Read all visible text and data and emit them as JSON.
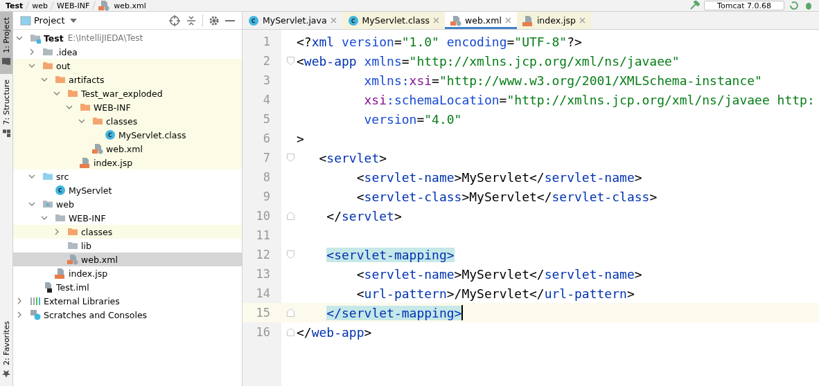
{
  "breadcrumb": [
    "Test",
    "web",
    "WEB-INF",
    "web.xml"
  ],
  "run_config": {
    "label": "Tomcat 7.0.68"
  },
  "tool_stripe": {
    "top": [
      {
        "label": "1: Project",
        "selected": true
      },
      {
        "label": "7: Structure",
        "selected": false
      }
    ],
    "bottom": [
      {
        "label": "2: Favorites",
        "selected": false
      }
    ]
  },
  "project_panel": {
    "title": "Project",
    "tree": [
      {
        "label": "Test",
        "detail": "E:\\IntelliJIEDA\\Test",
        "kind": "module",
        "expanded": true,
        "selected": false,
        "excluded": false,
        "children": [
          {
            "label": ".idea",
            "kind": "folder",
            "expanded": false,
            "selected": false,
            "excluded": false
          },
          {
            "label": "out",
            "kind": "folder_excluded",
            "expanded": true,
            "selected": false,
            "excluded": true,
            "children": [
              {
                "label": "artifacts",
                "kind": "folder_excluded",
                "expanded": true,
                "selected": false,
                "excluded": true,
                "children": [
                  {
                    "label": "Test_war_exploded",
                    "kind": "folder_excluded",
                    "expanded": true,
                    "selected": false,
                    "excluded": true,
                    "children": [
                      {
                        "label": "WEB-INF",
                        "kind": "folder_excluded",
                        "expanded": true,
                        "selected": false,
                        "excluded": true,
                        "children": [
                          {
                            "label": "classes",
                            "kind": "folder_excluded",
                            "expanded": true,
                            "selected": false,
                            "excluded": true,
                            "children": [
                              {
                                "label": "MyServlet.class",
                                "kind": "class",
                                "selected": false,
                                "excluded": true
                              }
                            ]
                          },
                          {
                            "label": "web.xml",
                            "kind": "xml",
                            "selected": false,
                            "excluded": true
                          }
                        ]
                      },
                      {
                        "label": "index.jsp",
                        "kind": "jsp",
                        "selected": false,
                        "excluded": true
                      }
                    ]
                  }
                ]
              }
            ]
          },
          {
            "label": "src",
            "kind": "folder_source",
            "expanded": true,
            "selected": false,
            "excluded": false,
            "children": [
              {
                "label": "MyServlet",
                "kind": "class",
                "selected": false,
                "excluded": false
              }
            ]
          },
          {
            "label": "web",
            "kind": "folder_web",
            "expanded": true,
            "selected": false,
            "excluded": false,
            "children": [
              {
                "label": "WEB-INF",
                "kind": "folder",
                "expanded": true,
                "selected": false,
                "excluded": false,
                "children": [
                  {
                    "label": "classes",
                    "kind": "folder_excluded",
                    "expanded": false,
                    "selected": false,
                    "excluded": true
                  },
                  {
                    "label": "lib",
                    "kind": "folder",
                    "selected": false,
                    "excluded": false
                  },
                  {
                    "label": "web.xml",
                    "kind": "xml",
                    "selected": true,
                    "excluded": false
                  }
                ]
              },
              {
                "label": "index.jsp",
                "kind": "jsp",
                "selected": false,
                "excluded": false
              }
            ]
          },
          {
            "label": "Test.iml",
            "kind": "iml",
            "selected": false,
            "excluded": false
          }
        ]
      },
      {
        "label": "External Libraries",
        "kind": "libraries",
        "expanded": false,
        "selected": false,
        "excluded": false
      },
      {
        "label": "Scratches and Consoles",
        "kind": "scratches",
        "expanded": false,
        "selected": false,
        "excluded": false
      }
    ]
  },
  "editor": {
    "tabs": [
      {
        "label": "MyServlet.java",
        "kind": "class",
        "selected": false,
        "excluded": false
      },
      {
        "label": "MyServlet.class",
        "kind": "class",
        "selected": false,
        "excluded": true
      },
      {
        "label": "web.xml",
        "kind": "xml",
        "selected": true,
        "excluded": false
      },
      {
        "label": "index.jsp",
        "kind": "jsp",
        "selected": false,
        "excluded": true
      }
    ],
    "lines": [
      {
        "number": "1",
        "current": false,
        "tokens": [
          {
            "kind": "punct",
            "text": "<?"
          },
          {
            "kind": "tag",
            "text": "xml"
          },
          {
            "kind": "attr",
            "text": " version"
          },
          {
            "kind": "punct",
            "text": "="
          },
          {
            "kind": "value",
            "text": "\"1.0\""
          },
          {
            "kind": "attr",
            "text": " encoding"
          },
          {
            "kind": "punct",
            "text": "="
          },
          {
            "kind": "value",
            "text": "\"UTF-8\""
          },
          {
            "kind": "punct",
            "text": "?>"
          }
        ]
      },
      {
        "number": "2",
        "current": false,
        "fold_start": true,
        "tokens": [
          {
            "kind": "punct",
            "text": "<"
          },
          {
            "kind": "tag",
            "text": "web-app"
          },
          {
            "kind": "attr",
            "text": " xmlns"
          },
          {
            "kind": "punct",
            "text": "="
          },
          {
            "kind": "value",
            "text": "\"http://xmlns.jcp.org/xml/ns/javaee\""
          }
        ]
      },
      {
        "number": "3",
        "current": false,
        "tokens": [
          {
            "kind": "attr",
            "text": "         xmlns:"
          },
          {
            "kind": "ns",
            "text": "xsi"
          },
          {
            "kind": "punct",
            "text": "="
          },
          {
            "kind": "value",
            "text": "\"http://www.w3.org/2001/XMLSchema-instance\""
          }
        ]
      },
      {
        "number": "4",
        "current": false,
        "tokens": [
          {
            "kind": "ns",
            "text": "         xsi"
          },
          {
            "kind": "attr",
            "text": ":schemaLocation"
          },
          {
            "kind": "punct",
            "text": "="
          },
          {
            "kind": "value",
            "text": "\"http://xmlns.jcp.org/xml/ns/javaee http:"
          }
        ]
      },
      {
        "number": "5",
        "current": false,
        "tokens": [
          {
            "kind": "attr",
            "text": "         version"
          },
          {
            "kind": "punct",
            "text": "="
          },
          {
            "kind": "value",
            "text": "\"4.0\""
          }
        ]
      },
      {
        "number": "6",
        "current": false,
        "tokens": [
          {
            "kind": "punct",
            "text": ">"
          }
        ]
      },
      {
        "number": "7",
        "current": false,
        "fold_start": true,
        "tokens": [
          {
            "kind": "punct",
            "text": "   <"
          },
          {
            "kind": "tag",
            "text": "servlet"
          },
          {
            "kind": "punct",
            "text": ">"
          }
        ]
      },
      {
        "number": "8",
        "current": false,
        "tokens": [
          {
            "kind": "punct",
            "text": "        <"
          },
          {
            "kind": "tag",
            "text": "servlet-name"
          },
          {
            "kind": "punct",
            "text": ">"
          },
          {
            "kind": "text",
            "text": "MyServlet"
          },
          {
            "kind": "punct",
            "text": "</"
          },
          {
            "kind": "tag",
            "text": "servlet-name"
          },
          {
            "kind": "punct",
            "text": ">"
          }
        ]
      },
      {
        "number": "9",
        "current": false,
        "tokens": [
          {
            "kind": "punct",
            "text": "        <"
          },
          {
            "kind": "tag",
            "text": "servlet-class"
          },
          {
            "kind": "punct",
            "text": ">"
          },
          {
            "kind": "text",
            "text": "MyServlet"
          },
          {
            "kind": "punct",
            "text": "</"
          },
          {
            "kind": "tag",
            "text": "servlet-class"
          },
          {
            "kind": "punct",
            "text": ">"
          }
        ]
      },
      {
        "number": "10",
        "current": false,
        "fold_end": true,
        "tokens": [
          {
            "kind": "punct",
            "text": "    </"
          },
          {
            "kind": "tag",
            "text": "servlet"
          },
          {
            "kind": "punct",
            "text": ">"
          }
        ]
      },
      {
        "number": "11",
        "current": false
      },
      {
        "number": "12",
        "current": false,
        "fold_start": true,
        "tokens": [
          {
            "kind": "match",
            "text": "    <servlet-mapping>"
          }
        ]
      },
      {
        "number": "13",
        "current": false,
        "tokens": [
          {
            "kind": "punct",
            "text": "        <"
          },
          {
            "kind": "tag",
            "text": "servlet-name"
          },
          {
            "kind": "punct",
            "text": ">"
          },
          {
            "kind": "text",
            "text": "MyServlet"
          },
          {
            "kind": "punct",
            "text": "</"
          },
          {
            "kind": "tag",
            "text": "servlet-name"
          },
          {
            "kind": "punct",
            "text": ">"
          }
        ]
      },
      {
        "number": "14",
        "current": false,
        "tokens": [
          {
            "kind": "punct",
            "text": "        <"
          },
          {
            "kind": "tag",
            "text": "url-pattern"
          },
          {
            "kind": "punct",
            "text": ">"
          },
          {
            "kind": "text",
            "text": "/MyServlet"
          },
          {
            "kind": "punct",
            "text": "</"
          },
          {
            "kind": "tag",
            "text": "url-pattern"
          },
          {
            "kind": "punct",
            "text": ">"
          }
        ]
      },
      {
        "number": "15",
        "current": true,
        "fold_end": true,
        "tokens": [
          {
            "kind": "match",
            "text": "    </servlet-mapping>"
          }
        ]
      },
      {
        "number": "16",
        "current": false,
        "fold_end": true,
        "tokens": [
          {
            "kind": "punct",
            "text": "</"
          },
          {
            "kind": "tag",
            "text": "web-app"
          },
          {
            "kind": "punct",
            "text": ">"
          }
        ]
      }
    ]
  }
}
